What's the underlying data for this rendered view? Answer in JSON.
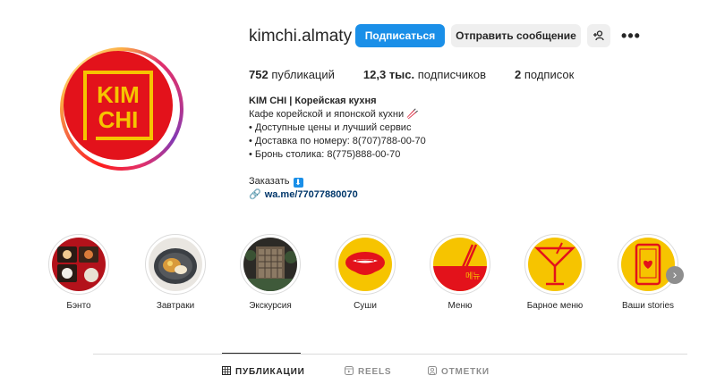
{
  "profile": {
    "username": "kimchi.almaty",
    "logo_text_top": "KIM",
    "logo_text_bottom": "CHI",
    "follow_label": "Подписаться",
    "message_label": "Отправить сообщение",
    "more_label": "•••"
  },
  "stats": {
    "posts_count": "752",
    "posts_label": "публикаций",
    "followers_count": "12,3 тыс.",
    "followers_label": "подписчиков",
    "following_count": "2",
    "following_label": "подписок"
  },
  "bio": {
    "name": "KIM CHI | Корейская кухня",
    "line1": "Кафе корейской и японской кухни 🥢",
    "line2": "• Доступные цены и лучший сервис",
    "line3": "• Доставка по номеру: 8(707)788-00-70",
    "line4": "• Бронь столика: 8(775)888-00-70",
    "order_label": "Заказать",
    "order_icon": "⬇",
    "link": "wa.me/77077880070"
  },
  "highlights": [
    {
      "label": "Бэнто"
    },
    {
      "label": "Завтраки"
    },
    {
      "label": "Экскурсия"
    },
    {
      "label": "Суши"
    },
    {
      "label": "Меню",
      "glyph": "메뉴"
    },
    {
      "label": "Барное меню"
    },
    {
      "label": "Ваши stories"
    }
  ],
  "tabs": {
    "posts": "ПУБЛИКАЦИИ",
    "reels": "REELS",
    "tagged": "ОТМЕТКИ"
  },
  "colors": {
    "brand_red": "#e3121b",
    "brand_yellow": "#f6c400",
    "accent_blue": "#1a8fe8"
  }
}
